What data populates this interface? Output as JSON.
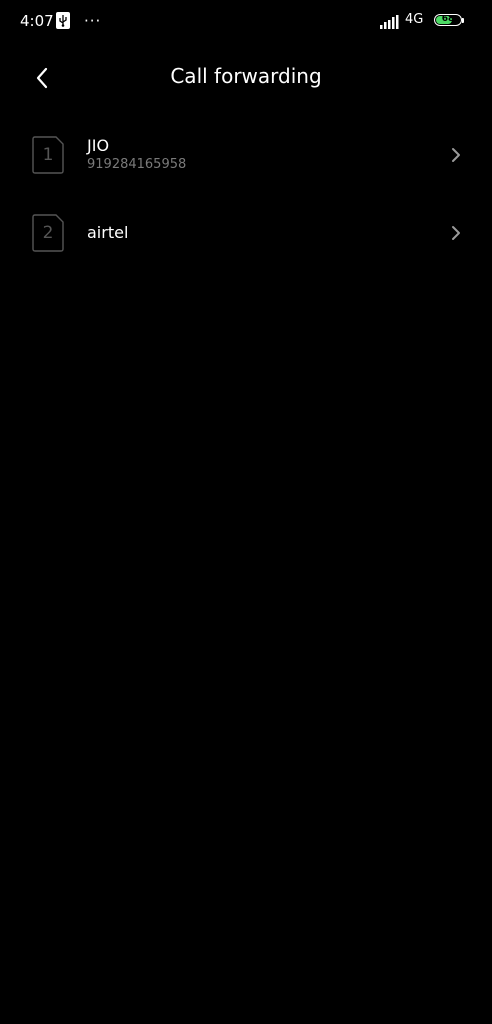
{
  "status_bar": {
    "time": "4:07",
    "more": "···",
    "network_type": "4G",
    "battery_level": "68",
    "battery_fraction": 0.68
  },
  "header": {
    "title": "Call forwarding"
  },
  "sims": [
    {
      "slot": "1",
      "name": "JIO",
      "number": "919284165958"
    },
    {
      "slot": "2",
      "name": "airtel",
      "number": ""
    }
  ],
  "colors": {
    "background": "#000000",
    "text_primary": "#ffffff",
    "text_secondary": "#7a7a7a",
    "battery_fill": "#4cd964"
  }
}
